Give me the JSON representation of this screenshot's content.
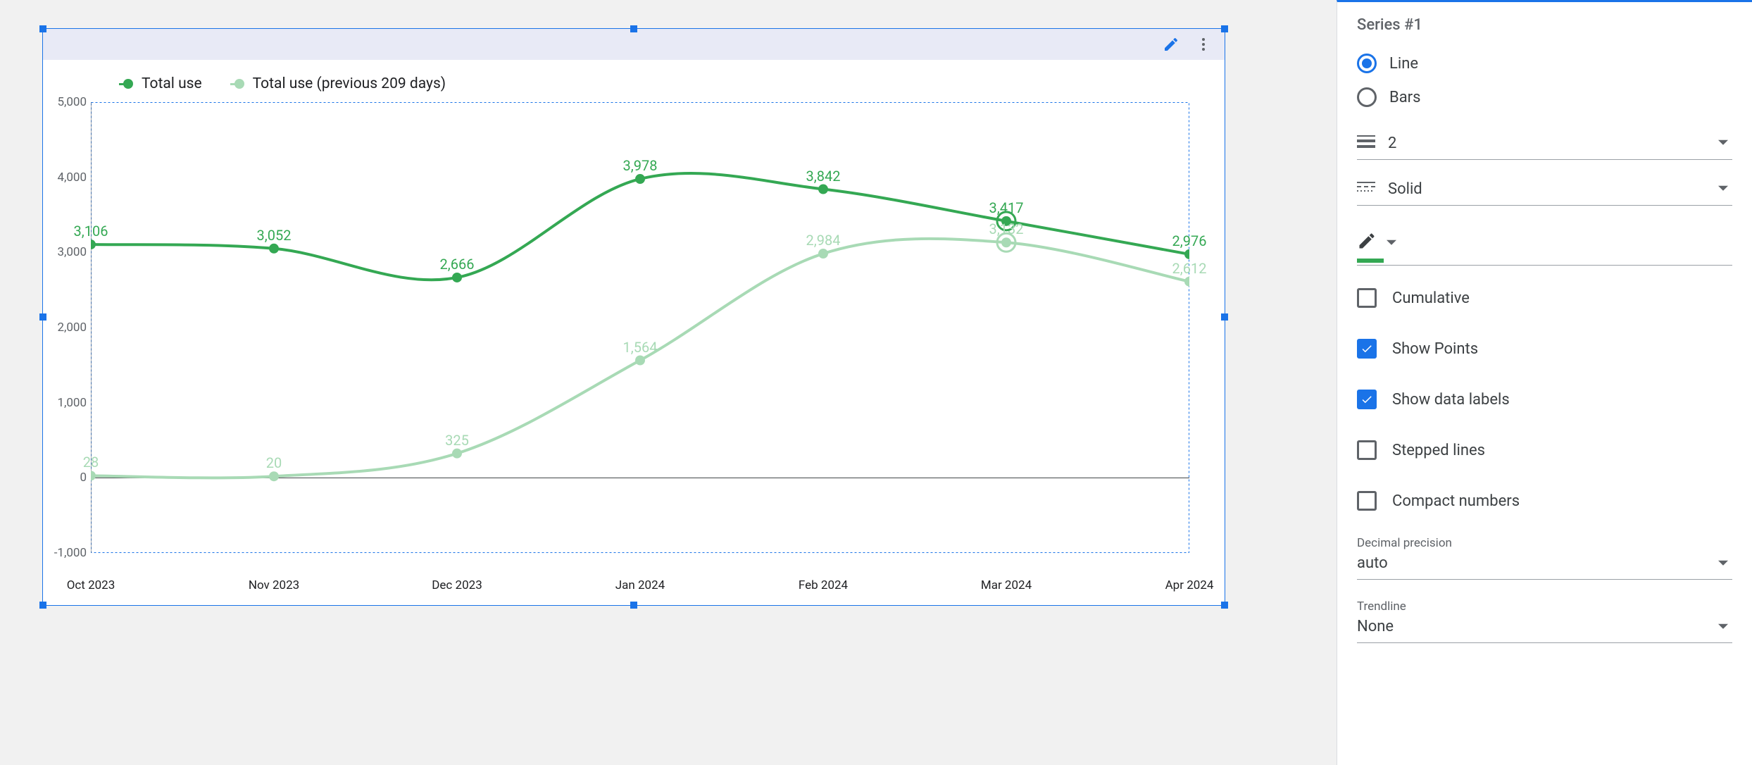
{
  "chart_data": {
    "type": "line",
    "categories": [
      "Oct 2023",
      "Nov 2023",
      "Dec 2023",
      "Jan 2024",
      "Feb 2024",
      "Mar 2024",
      "Apr 2024"
    ],
    "ylim": [
      -1000,
      5000
    ],
    "yticks": [
      -1000,
      0,
      1000,
      2000,
      3000,
      4000,
      5000
    ],
    "series": [
      {
        "name": "Total use",
        "color": "#34a853",
        "values": [
          3106,
          3052,
          2666,
          3978,
          3842,
          3417,
          2976
        ]
      },
      {
        "name": "Total use (previous 209 days)",
        "color": "#a8dab5",
        "values": [
          28,
          20,
          325,
          1564,
          2984,
          3132,
          2612
        ]
      }
    ],
    "title": "",
    "xlabel": "",
    "ylabel": ""
  },
  "sidebar": {
    "series_title": "Series #1",
    "chart_type": {
      "options": {
        "line": "Line",
        "bars": "Bars"
      },
      "selected": "line"
    },
    "line_weight": "2",
    "line_style": "Solid",
    "checkboxes": {
      "cumulative": {
        "label": "Cumulative",
        "checked": false
      },
      "show_points": {
        "label": "Show Points",
        "checked": true
      },
      "show_data_labels": {
        "label": "Show data labels",
        "checked": true
      },
      "stepped_lines": {
        "label": "Stepped lines",
        "checked": false
      },
      "compact_numbers": {
        "label": "Compact numbers",
        "checked": false
      }
    },
    "decimal_precision_label": "Decimal precision",
    "decimal_precision_value": "auto",
    "trendline_label": "Trendline",
    "trendline_value": "None"
  }
}
